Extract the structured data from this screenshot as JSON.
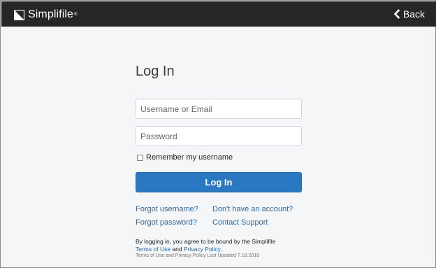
{
  "header": {
    "brand": "Simplifile",
    "trademark": "®",
    "back_label": "Back",
    "icons": {
      "logo": "simplifile-logo-mark",
      "back": "chevron-left-icon"
    }
  },
  "login": {
    "title": "Log In",
    "username_placeholder": "Username or Email",
    "username_value": "",
    "password_placeholder": "Password",
    "password_value": "",
    "remember_label": "Remember my username",
    "remember_checked": false,
    "submit_label": "Log In",
    "links": {
      "forgot_username": "Forgot username?",
      "no_account": "Don't have an account?",
      "forgot_password": "Forgot password?",
      "contact_support": "Contact Support"
    },
    "legal": {
      "prefix": "By logging in, you agree to be bound by the Simplifile",
      "terms": "Terms of Use",
      "and": "and",
      "privacy": "Privacy Policy",
      "period": ".",
      "updated": "Terms of Use and Privacy Policy Last Updated 7.18.2018"
    }
  },
  "colors": {
    "topbar": "#262626",
    "background": "#f5f6f8",
    "primary_button": "#2a78c2",
    "link": "#2a67a8"
  }
}
